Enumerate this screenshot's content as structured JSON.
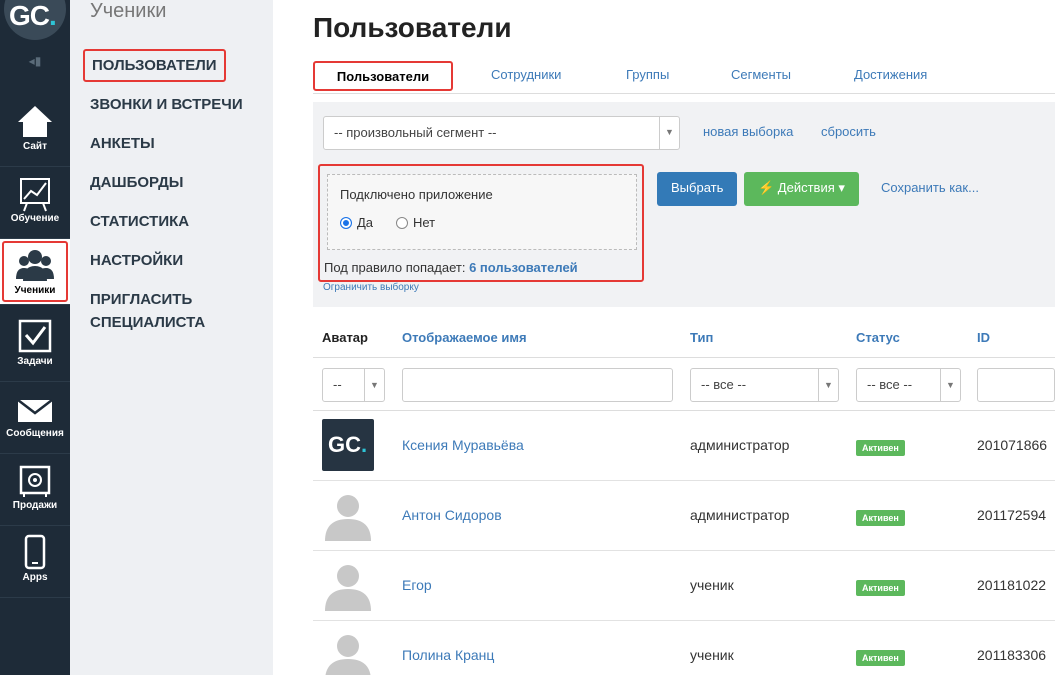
{
  "rail": {
    "items": [
      {
        "label": "Сайт",
        "icon": "house-icon"
      },
      {
        "label": "Обучение",
        "icon": "chart-board-icon"
      },
      {
        "label": "Ученики",
        "icon": "users-icon"
      },
      {
        "label": "Задачи",
        "icon": "checkbox-icon"
      },
      {
        "label": "Сообщения",
        "icon": "envelope-icon"
      },
      {
        "label": "Продажи",
        "icon": "safe-icon"
      },
      {
        "label": "Apps",
        "icon": "phone-icon"
      }
    ],
    "logo_text": "GC",
    "logo_dot": "."
  },
  "submenu": {
    "heading": "Ученики",
    "items": [
      "ПОЛЬЗОВАТЕЛИ",
      "ЗВОНКИ И ВСТРЕЧИ",
      "АНКЕТЫ",
      "ДАШБОРДЫ",
      "СТАТИСТИКА",
      "НАСТРОЙКИ",
      "ПРИГЛАСИТЬ",
      "СПЕЦИАЛИСТА"
    ]
  },
  "main": {
    "title": "Пользователи",
    "tabs": [
      "Пользователи",
      "Сотрудники",
      "Группы",
      "Сегменты",
      "Достижения"
    ]
  },
  "filter": {
    "segment_select": "-- произвольный сегмент --",
    "new_selection": "новая выборка",
    "reset": "сбросить",
    "rule_title": "Подключено приложение",
    "radio_yes": "Да",
    "radio_no": "Нет",
    "rule_count_prefix": "Под правило попадает:",
    "rule_count_value": "6 пользователей",
    "limit_link": "Ограничить выборку",
    "select_button": "Выбрать",
    "actions_button": "⚡ Действия ▾",
    "save_as": "Сохранить как..."
  },
  "table": {
    "headers": {
      "avatar": "Аватар",
      "name": "Отображаемое имя",
      "type": "Тип",
      "status": "Статус",
      "id": "ID"
    },
    "filters": {
      "avatar": "--",
      "type": "-- все --",
      "status": "-- все --"
    },
    "rows": [
      {
        "name": "Ксения Муравьёва",
        "type": "администратор",
        "status": "Активен",
        "id": "201071866"
      },
      {
        "name": "Антон Сидоров",
        "type": "администратор",
        "status": "Активен",
        "id": "201172594"
      },
      {
        "name": "Егор",
        "type": "ученик",
        "status": "Активен",
        "id": "201181022"
      },
      {
        "name": "Полина Кранц",
        "type": "ученик",
        "status": "Активен",
        "id": "201183306"
      }
    ]
  },
  "colors": {
    "accent": "#3d7ab8",
    "highlight": "#e53935",
    "success": "#5cb85c",
    "rail": "#1e2b38"
  }
}
